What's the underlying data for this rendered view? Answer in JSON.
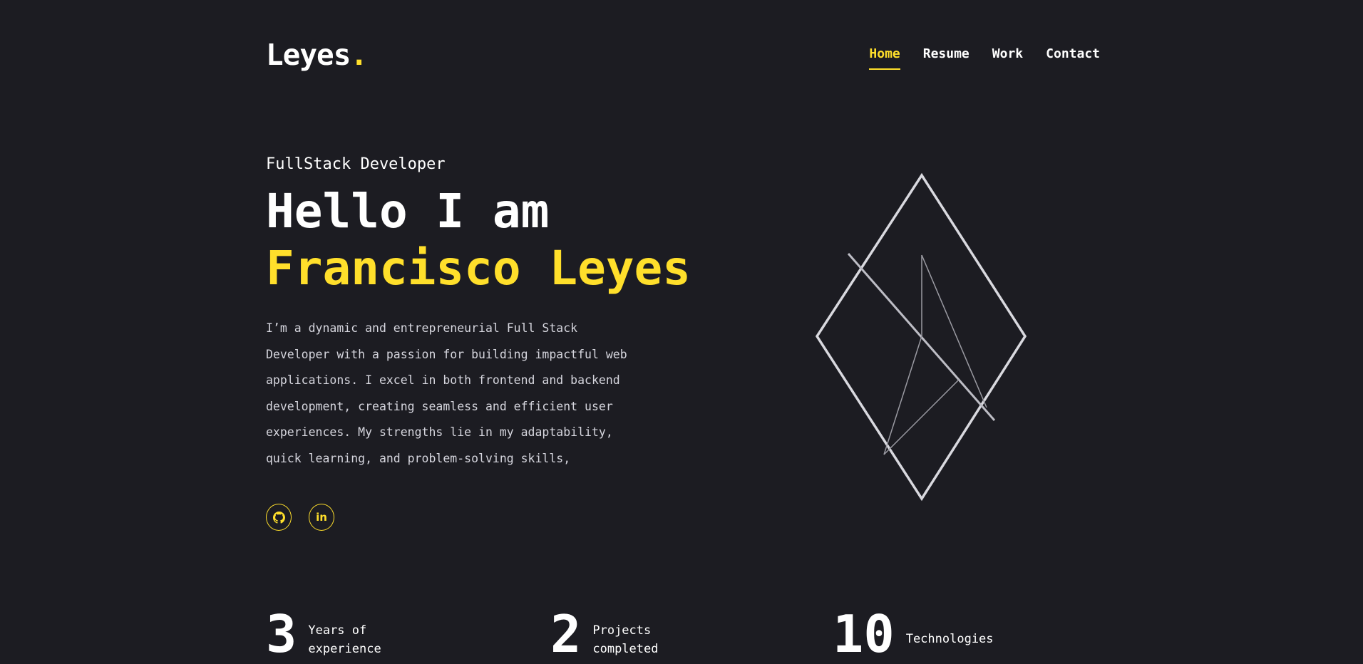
{
  "header": {
    "logo_text": "Leyes",
    "logo_dot": "."
  },
  "nav": {
    "items": [
      {
        "label": "Home",
        "active": true
      },
      {
        "label": "Resume",
        "active": false
      },
      {
        "label": "Work",
        "active": false
      },
      {
        "label": "Contact",
        "active": false
      }
    ]
  },
  "hero": {
    "role": "FullStack Developer",
    "greeting": "Hello I am",
    "name": "Francisco Leyes",
    "bio": "I’m a dynamic and entrepreneurial Full Stack Developer with a passion for building impactful web applications. I excel in both frontend and backend development, creating seamless and efficient user experiences. My strengths lie in my adaptability, quick learning, and problem-solving skills,"
  },
  "socials": [
    {
      "icon": "github-icon"
    },
    {
      "icon": "linkedin-icon",
      "glyph": "in"
    }
  ],
  "stats": [
    {
      "number": "3",
      "label_line1": "Years of",
      "label_line2": "experience"
    },
    {
      "number": "2",
      "label_line1": "Projects",
      "label_line2": "completed"
    },
    {
      "number": "10",
      "label_line1": "Technologies",
      "label_line2": ""
    }
  ],
  "colors": {
    "background": "#1c1c22",
    "accent": "#ffdf2b",
    "text": "#ffffff"
  }
}
